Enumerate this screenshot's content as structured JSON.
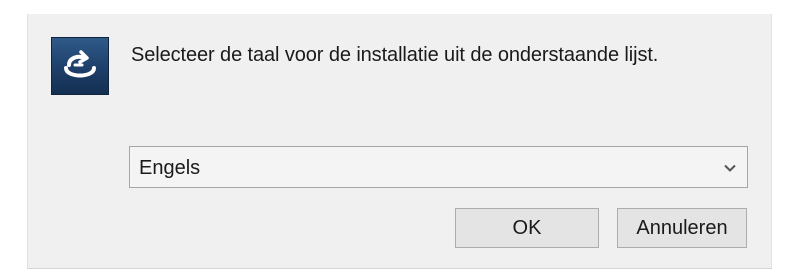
{
  "dialog": {
    "icon": "installer-icon",
    "message": "Selecteer de taal voor de installatie uit de onderstaande lijst."
  },
  "language_select": {
    "selected": "Engels",
    "icon": "chevron-down-icon"
  },
  "buttons": {
    "ok_label": "OK",
    "cancel_label": "Annuleren"
  },
  "colors": {
    "panel_background": "#f0f0f0",
    "icon_background": "#1d3f6a",
    "button_background": "#e4e4e4"
  }
}
